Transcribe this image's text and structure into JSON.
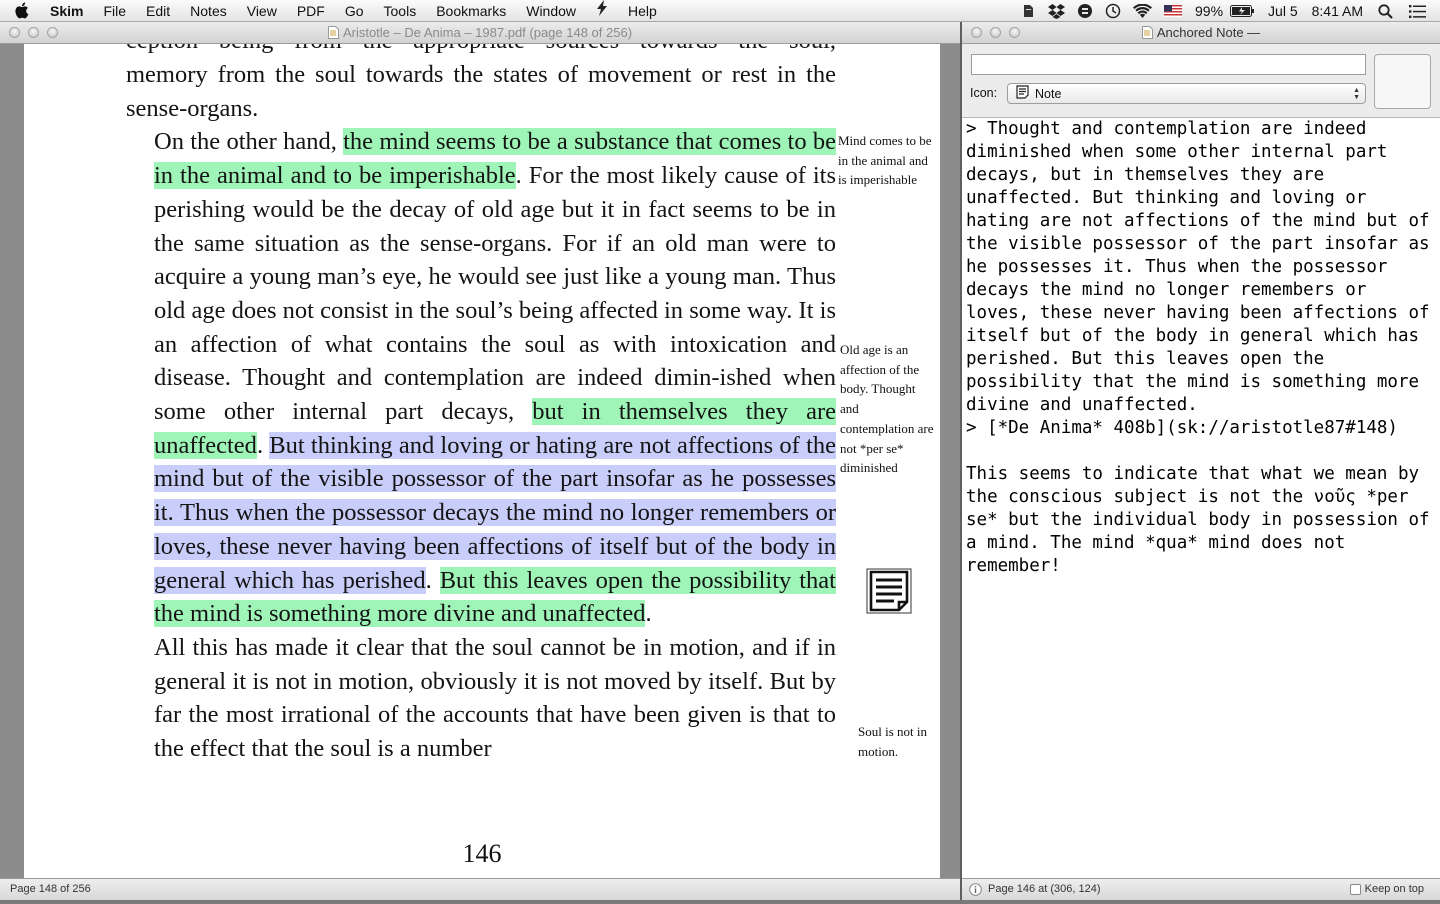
{
  "menubar": {
    "app_name": "Skim",
    "items": [
      "File",
      "Edit",
      "Notes",
      "View",
      "PDF",
      "Go",
      "Tools",
      "Bookmarks",
      "Window",
      "Help"
    ],
    "battery": "99%",
    "date": "Jul 5",
    "time": "8:41 AM"
  },
  "pdf_window": {
    "title": "Aristotle – De Anima – 1987.pdf (page 148 of 256)",
    "status": "Page 148 of 256",
    "page_number": "146",
    "top_cut_line": "ception being from the appropriate sources towards the soul,",
    "paragraphs": [
      {
        "first": "",
        "segments": [
          {
            "t": "memory from the soul towards the states of movement or rest in the sense-organs.",
            "h": ""
          }
        ]
      },
      {
        "first": "ind",
        "segments": [
          {
            "t": "On the other hand, ",
            "h": ""
          },
          {
            "t": "the mind seems to be a substance that comes to be in the animal and to be imperishable",
            "h": "green"
          },
          {
            "t": ". For the most likely cause of its perishing would be the decay of old age but it in fact seems to be in the same situation as the sense-organs. For if an old man were to acquire a young man’s eye, he would see just like a young man. Thus old age does not consist in the soul’s being affected in some way. It is an affection of what contains the soul as with intoxication and disease. Thought and contemplation are indeed dimin-ished when some other internal part decays, ",
            "h": ""
          },
          {
            "t": "but in themselves they are unaffected",
            "h": "green"
          },
          {
            "t": ". ",
            "h": ""
          },
          {
            "t": "But thinking and loving or hating are not affections of the mind but of the visible possessor of the part insofar as he possesses it. Thus when the possessor decays the mind no longer remembers or loves, these never having been affections of itself but of the body in general which has perished",
            "h": "blue"
          },
          {
            "t": ". ",
            "h": ""
          },
          {
            "t": "But this leaves open the possibility that the mind is something more divine and unaffected",
            "h": "green"
          },
          {
            "t": ".",
            "h": ""
          }
        ]
      },
      {
        "first": "ind",
        "segments": [
          {
            "t": "All this has made it clear that the soul cannot be in motion, and if in general it is not in motion, obviously it is not moved by itself. But by far the most irrational of the accounts that have been given is that to the effect that the soul is a number",
            "h": ""
          }
        ]
      }
    ],
    "margin_notes": [
      "Mind comes to be in the animal and is imperishable",
      "Old age is an affection of the body. Thought and contemplation are not *per se* diminished",
      "Soul is not in motion."
    ]
  },
  "note_window": {
    "title": "Anchored Note —",
    "title_value": "",
    "icon_label": "Icon:",
    "icon_value": "Note",
    "text": "> Thought and contemplation are indeed diminished when some other internal part decays, but in themselves they are unaffected. But thinking and loving or hating are not affections of the mind but of the visible possessor of the part insofar as he possesses it. Thus when the possessor decays the mind no longer remembers or loves, these never having been affections of itself but of the body in general which has perished. But this leaves open the possibility that the mind is something more divine and unaffected.\n> [*De Anima* 408b](sk://aristotle87#148)\n\nThis seems to indicate that what we mean by the conscious subject is not the νοῦς *per se* but the individual body in possession of a mind. The mind *qua* mind does not remember!",
    "status": "Page 146 at (306, 124)",
    "keep_on_top": "Keep on top"
  },
  "colors": {
    "highlight_green": "#9ff5b8",
    "highlight_blue": "#c9cdfa"
  }
}
